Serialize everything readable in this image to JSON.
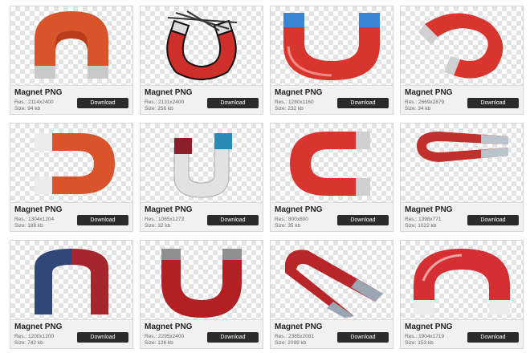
{
  "cards": [
    {
      "title": "Magnet PNG",
      "res": "Res.: 2114x2400",
      "size": "Size: 94 kb",
      "download": "Download",
      "icon": "orange-horseshoe-magnet-icon"
    },
    {
      "title": "Magnet PNG",
      "res": "Res.: 2131x2400",
      "size": "Size: 256 kb",
      "download": "Download",
      "icon": "cartoon-magnet-with-nails-icon"
    },
    {
      "title": "Magnet PNG",
      "res": "Res.: 1280x1160",
      "size": "Size: 232 kb",
      "download": "Download",
      "icon": "red-blue-horseshoe-magnet-icon"
    },
    {
      "title": "Magnet PNG",
      "res": "Res.: 2669x2879",
      "size": "Size: 34 kb",
      "download": "Download",
      "icon": "red-tilted-magnet-icon"
    },
    {
      "title": "Magnet PNG",
      "res": "Res.: 1304x1204",
      "size": "Size: 188 kb",
      "download": "Download",
      "icon": "orange-sideways-magnet-icon"
    },
    {
      "title": "Magnet PNG",
      "res": "Res.: 1065x1273",
      "size": "Size: 32 kb",
      "download": "Download",
      "icon": "gray-magnet-red-blue-ends-icon"
    },
    {
      "title": "Magnet PNG",
      "res": "Res.: 800x800",
      "size": "Size: 35 kb",
      "download": "Download",
      "icon": "red-sideways-magnet-icon"
    },
    {
      "title": "Magnet PNG",
      "res": "Res.: 1398x771",
      "size": "Size: 1022 kb",
      "download": "Download",
      "icon": "thin-sideways-magnet-icon"
    },
    {
      "title": "Magnet PNG",
      "res": "Res.: 1200x1200",
      "size": "Size: 742 kb",
      "download": "Download",
      "icon": "blue-red-magnet-icon"
    },
    {
      "title": "Magnet PNG",
      "res": "Res.: 2295x2400",
      "size": "Size: 126 kb",
      "download": "Download",
      "icon": "dark-red-magnet-icon"
    },
    {
      "title": "Magnet PNG",
      "res": "Res.: 2385x2081",
      "size": "Size: 2099 kb",
      "download": "Download",
      "icon": "diagonal-red-magnet-icon"
    },
    {
      "title": "Magnet PNG",
      "res": "Res.: 1904x1719",
      "size": "Size: 153 kb",
      "download": "Download",
      "icon": "glossy-red-magnet-icon"
    }
  ],
  "colors": {
    "button_bg": "#2b2b2b",
    "info_bg": "#f1f1f1",
    "magnet_red": "#d8352f",
    "magnet_orange": "#d9542a",
    "tip_gray": "#c9c9c9"
  }
}
